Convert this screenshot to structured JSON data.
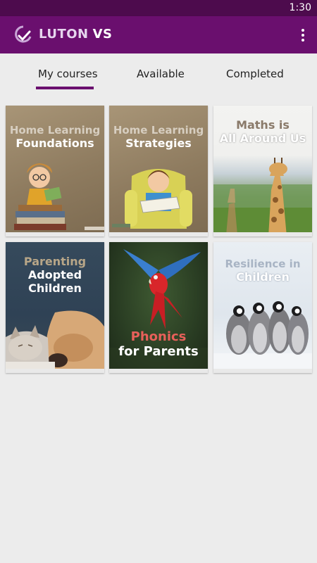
{
  "status_bar": {
    "time": "1:30"
  },
  "app_bar": {
    "title_part1": "LUTON",
    "title_part2": "VS",
    "logo_icon": "check-circle-logo-icon",
    "menu_icon": "more-vert-icon"
  },
  "tabs": [
    {
      "label": "My courses",
      "selected": true
    },
    {
      "label": "Available",
      "selected": false
    },
    {
      "label": "Completed",
      "selected": false
    }
  ],
  "colors": {
    "primary": "#6a0f6e",
    "status_bar": "#4d0b4d",
    "background": "#ececec"
  },
  "courses": [
    {
      "line1": "Home Learning",
      "line2": "Foundations"
    },
    {
      "line1": "Home Learning",
      "line2": "Strategies"
    },
    {
      "line1": "Maths is",
      "line2": "All Around Us"
    },
    {
      "line1": "Parenting",
      "line2": "Adopted",
      "line3": "Children"
    },
    {
      "line1": "Phonics",
      "line2": "for Parents"
    },
    {
      "line1": "Resilience in",
      "line2": "Children"
    }
  ]
}
